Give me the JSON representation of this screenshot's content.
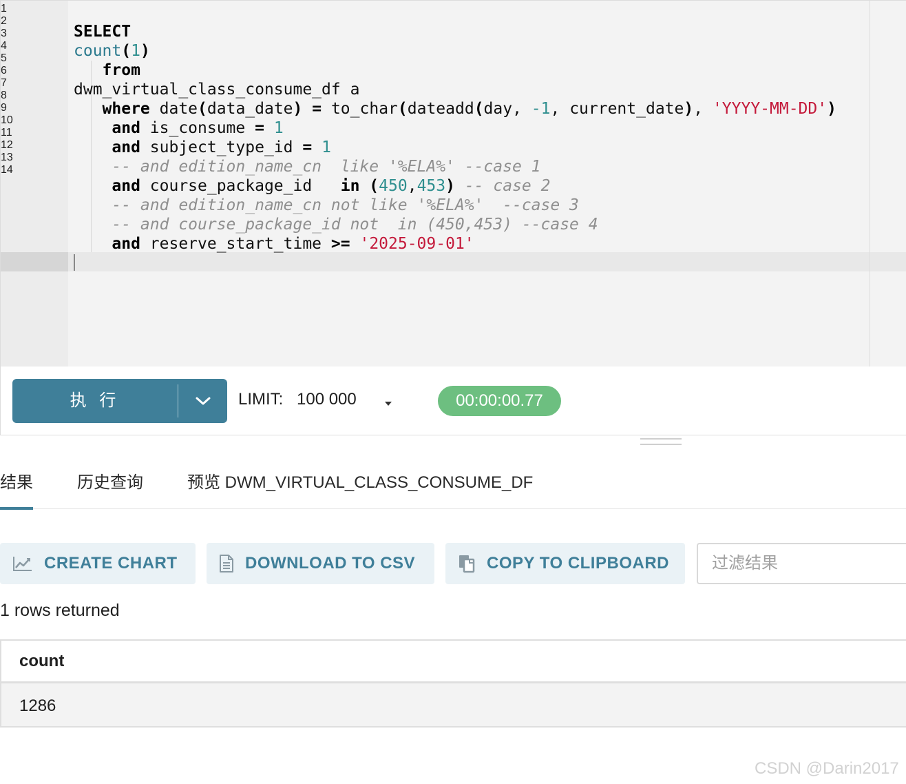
{
  "editor": {
    "line_numbers": [
      "1",
      "2",
      "3",
      "4",
      "5",
      "6",
      "7",
      "8",
      "9",
      "10",
      "11",
      "12",
      "13",
      "14"
    ],
    "lines": [
      "",
      "SELECT",
      "count(1)",
      "   from",
      "dwm_virtual_class_consume_df a",
      "   where date(data_date) = to_char(dateadd(day, -1, current_date), 'YYYY-MM-DD')",
      "    and is_consume = 1",
      "    and subject_type_id = 1",
      "    -- and edition_name_cn  like '%ELA%' --case 1",
      "    and course_package_id   in (450,453) -- case 2",
      "    -- and edition_name_cn not like '%ELA%'  --case 3",
      "    -- and course_package_id not  in (450,453) --case 4",
      "    and reserve_start_time >= '2025-09-01'",
      ""
    ],
    "active_line": 14
  },
  "toolbar": {
    "run_label": "执 行",
    "limit_label": "LIMIT:",
    "limit_value": "100 000",
    "timer": "00:00:00.77"
  },
  "tabs": [
    {
      "label": "结果",
      "active": true
    },
    {
      "label": "历史查询",
      "active": false
    },
    {
      "label": "预览 DWM_VIRTUAL_CLASS_CONSUME_DF",
      "active": false
    }
  ],
  "actions": {
    "create_chart": "CREATE CHART",
    "download_csv": "DOWNLOAD TO CSV",
    "copy_clipboard": "COPY TO CLIPBOARD",
    "filter_placeholder": "过滤结果"
  },
  "results": {
    "rows_returned": "1 rows returned",
    "columns": [
      "count"
    ],
    "rows": [
      [
        "1286"
      ]
    ]
  },
  "watermark": "CSDN @Darin2017",
  "colors": {
    "accent": "#3f7f99",
    "timer_green": "#6dbf80",
    "string_red": "#c41a3b",
    "number_teal": "#2f8f8f"
  }
}
